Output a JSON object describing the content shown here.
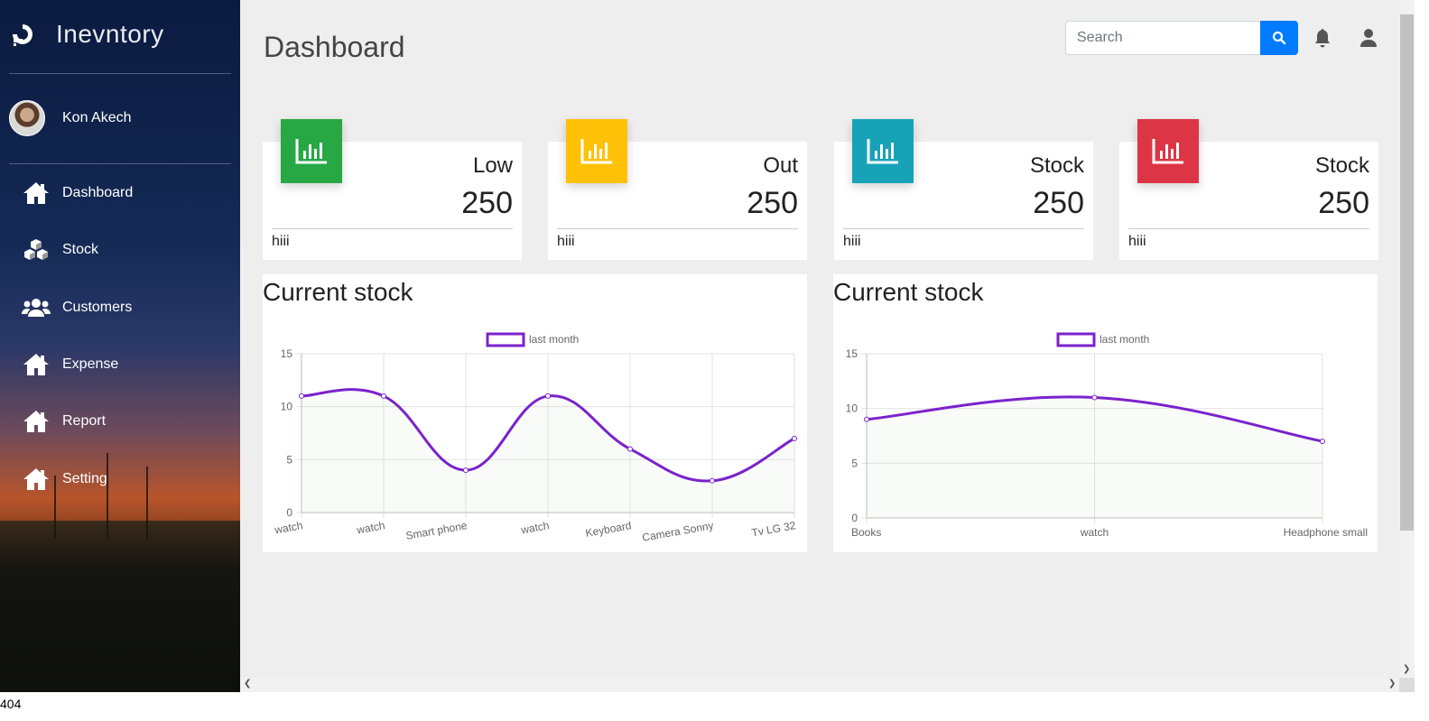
{
  "app": {
    "name": "Inevntory"
  },
  "user": {
    "name": "Kon Akech"
  },
  "nav": [
    {
      "label": "Dashboard",
      "icon": "home-icon"
    },
    {
      "label": "Stock",
      "icon": "cubes-icon"
    },
    {
      "label": "Customers",
      "icon": "users-icon"
    },
    {
      "label": "Expense",
      "icon": "home-icon"
    },
    {
      "label": "Report",
      "icon": "home-icon"
    },
    {
      "label": "Setting",
      "icon": "home-icon"
    }
  ],
  "header": {
    "title": "Dashboard",
    "search_placeholder": "Search"
  },
  "cards": [
    {
      "title": "Low",
      "value": "250",
      "footer": "hiii",
      "color": "#28a745"
    },
    {
      "title": "Out",
      "value": "250",
      "footer": "hiii",
      "color": "#ffc107"
    },
    {
      "title": "Stock",
      "value": "250",
      "footer": "hiii",
      "color": "#17a2b8"
    },
    {
      "title": "Stock",
      "value": "250",
      "footer": "hiii",
      "color": "#dc3545"
    }
  ],
  "chart_data": [
    {
      "type": "line",
      "title": "Current stock",
      "categories": [
        "watch",
        "watch",
        "Smart phone",
        "watch",
        "Keyboard",
        "Camera Sonny",
        "Tv LG 32"
      ],
      "series": [
        {
          "name": "last month",
          "values": [
            11,
            11,
            4,
            11,
            6,
            3,
            7
          ],
          "color": "#7b22cc"
        }
      ],
      "ylim": [
        0,
        15
      ],
      "yticks": [
        0,
        5,
        10,
        15
      ],
      "grid": true,
      "legend": "top"
    },
    {
      "type": "line",
      "title": "Current stock",
      "categories": [
        "Books",
        "watch",
        "Headphone small"
      ],
      "series": [
        {
          "name": "last month",
          "values": [
            9,
            11,
            7
          ],
          "color": "#7b22cc"
        }
      ],
      "ylim": [
        0,
        15
      ],
      "yticks": [
        0,
        5,
        10,
        15
      ],
      "grid": true,
      "legend": "top"
    }
  ],
  "status": {
    "text": "404"
  }
}
